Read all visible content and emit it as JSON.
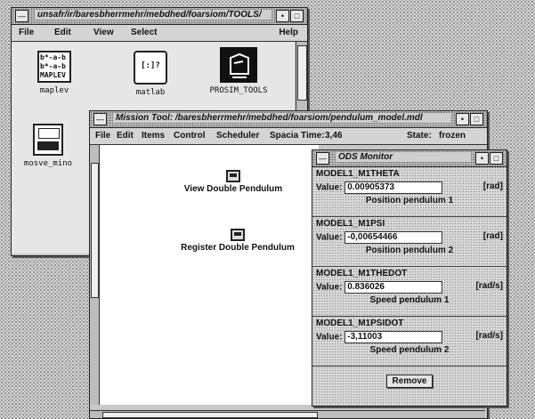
{
  "toolsWindow": {
    "title": "unsafr/ir/baresbherrmehr/mebdhed/foarsiom/TOOLS/",
    "menu": {
      "file": "File",
      "edit": "Edit",
      "view": "View",
      "select": "Select",
      "help": "Help"
    },
    "icons": [
      {
        "label": "maplev",
        "glyph": "b*-a-b\nb*-a-b\nMAPLEV"
      },
      {
        "label": "matlab",
        "glyph": "MATLAB"
      },
      {
        "label": "PROSIM_TOOLS",
        "glyph": ""
      },
      {
        "label": "mosve_mino",
        "glyph": ""
      }
    ]
  },
  "missionWindow": {
    "title": "Mission Tool: /baresbherrmehr/mebdhed/foarsiom/pendulum_model.mdl",
    "menu": {
      "file": "File",
      "edit": "Edit",
      "items": "Items",
      "control": "Control",
      "scheduler": "Scheduler",
      "spacia_time_label": "Spacia Time:",
      "spacia_time_value": "3,46",
      "state_label": "State:",
      "state_value": "frozen"
    },
    "items": [
      {
        "label": "View Double Pendulum"
      },
      {
        "label": "Register Double Pendulum"
      }
    ]
  },
  "odsMonitor": {
    "title": "ODS Monitor",
    "value_label": "Value:",
    "variables": [
      {
        "name": "MODEL1_M1THETA",
        "value": "0.00905373",
        "unit": "[rad]",
        "description": "Position pendulum 1"
      },
      {
        "name": "MODEL1_M1PSI",
        "value": "-0,00654466",
        "unit": "[rad]",
        "description": "Position pendulum 2"
      },
      {
        "name": "MODEL1_M1THEDOT",
        "value": "0.836026",
        "unit": "[rad/s]",
        "description": "Speed pendulum 1"
      },
      {
        "name": "MODEL1_M1PSIDOT",
        "value": "-3,11003",
        "unit": "[rad/s]",
        "description": "Speed pendulum 2"
      }
    ],
    "remove_label": "Remove"
  }
}
